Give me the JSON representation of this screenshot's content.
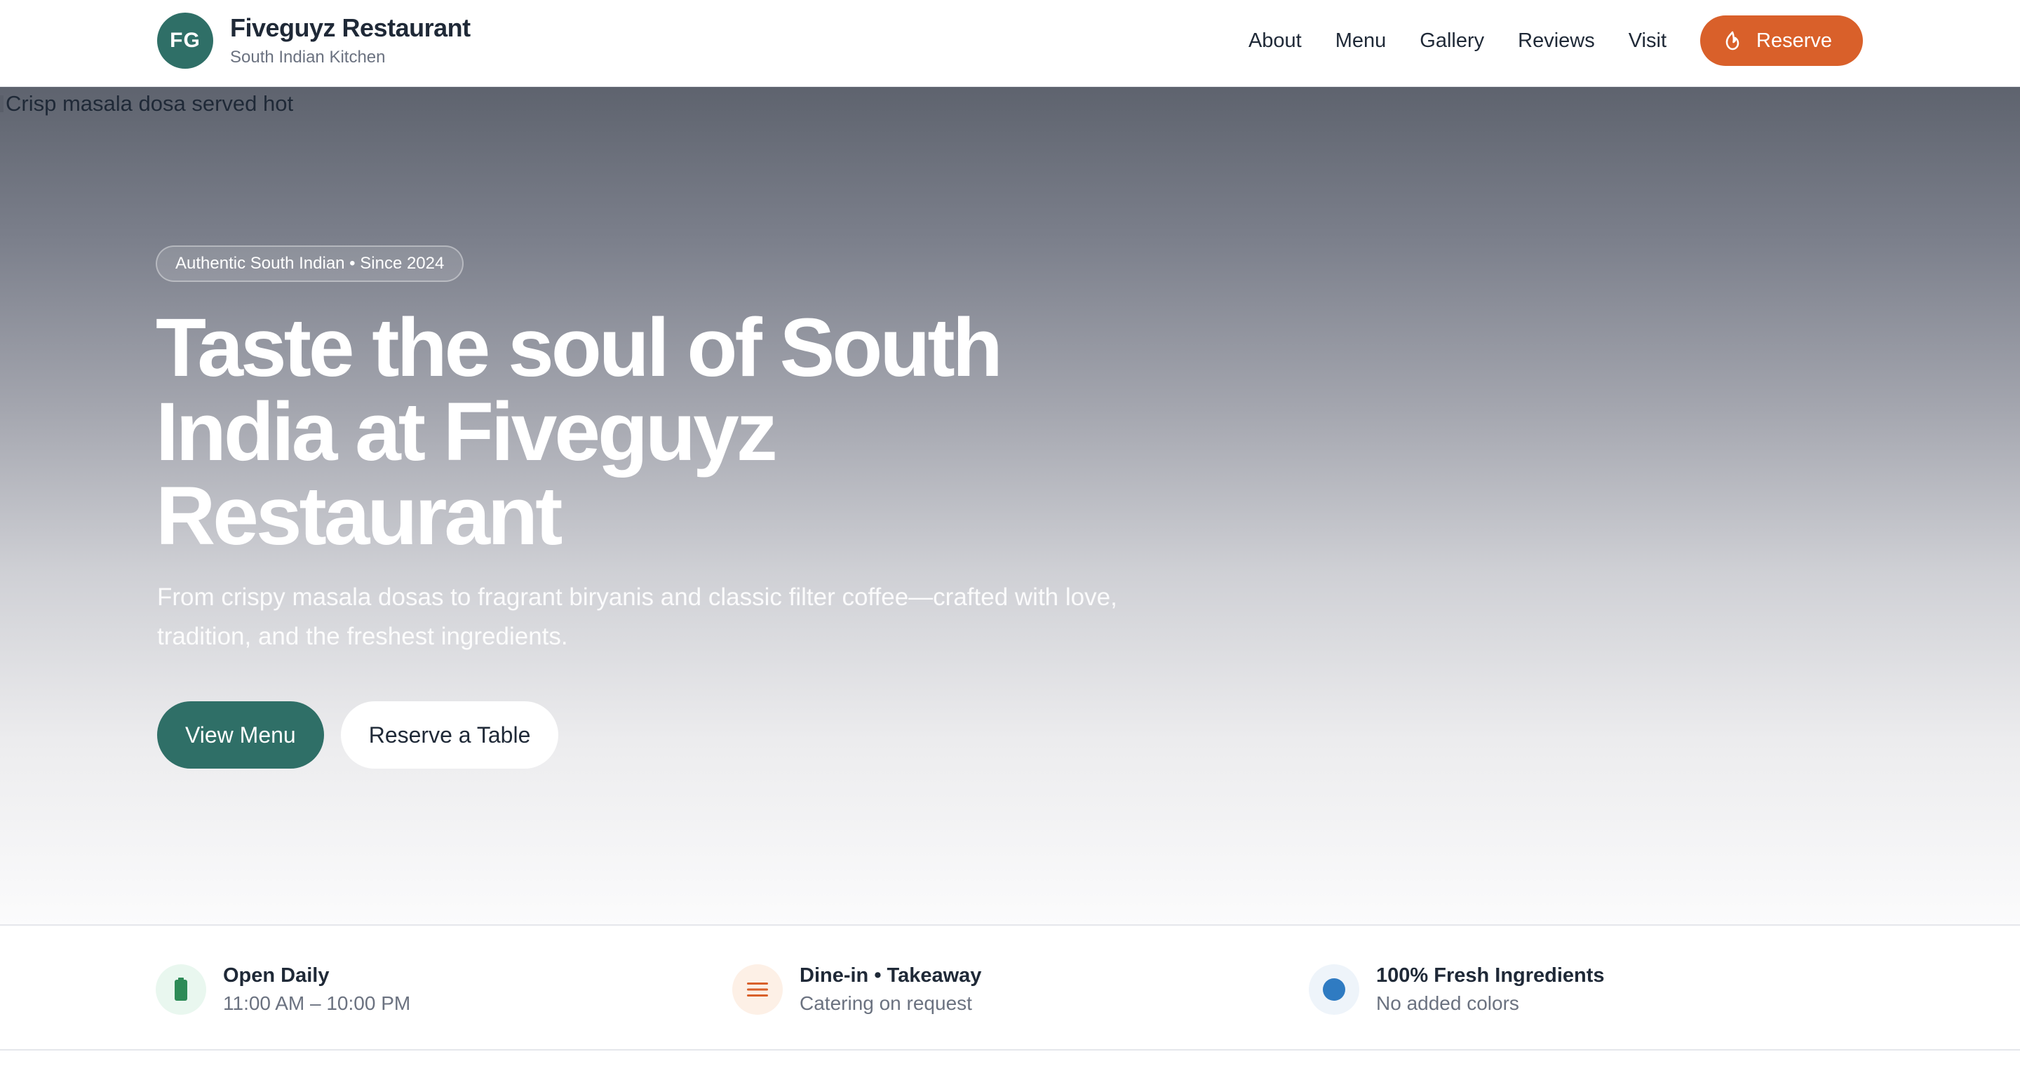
{
  "header": {
    "logo_initials": "FG",
    "brand_name": "Fiveguyz Restaurant",
    "brand_tagline": "South Indian Kitchen",
    "nav": [
      {
        "label": "About"
      },
      {
        "label": "Menu"
      },
      {
        "label": "Gallery"
      },
      {
        "label": "Reviews"
      },
      {
        "label": "Visit"
      }
    ],
    "reserve_label": "Reserve",
    "reserve_icon": "flame-icon"
  },
  "hero": {
    "image_alt": "Crisp masala dosa served hot",
    "badge": "Authentic South Indian • Since 2024",
    "title": "Taste the soul of South India at Fiveguyz Restaurant",
    "subtitle": "From crispy masala dosas to fragrant biryanis and classic filter coffee—crafted with love, tradition, and the freshest ingredients.",
    "primary_cta": "View Menu",
    "secondary_cta": "Reserve a Table"
  },
  "info": [
    {
      "icon": "battery-icon",
      "title": "Open Daily",
      "subtitle": "11:00 AM – 10:00 PM",
      "icon_color": "#2e8b57",
      "icon_bg": "#e9f7ef"
    },
    {
      "icon": "menu-lines-icon",
      "title": "Dine-in • Takeaway",
      "subtitle": "Catering on request",
      "icon_color": "#d9602a",
      "icon_bg": "#fdf0e6"
    },
    {
      "icon": "circle-icon",
      "title": "100% Fresh Ingredients",
      "subtitle": "No added colors",
      "icon_color": "#2f7bc2",
      "icon_bg": "#eef4fa"
    }
  ],
  "colors": {
    "brand_green": "#2f6f67",
    "accent_orange": "#d9602a",
    "text_dark": "#1f2937",
    "text_muted": "#6b7280"
  }
}
